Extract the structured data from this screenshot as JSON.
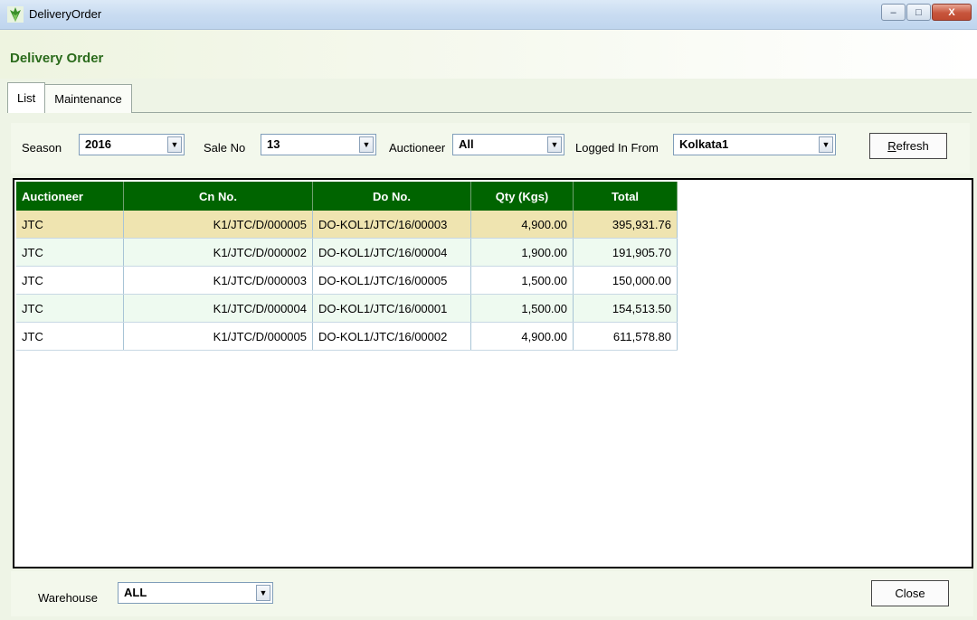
{
  "window": {
    "title": "DeliveryOrder",
    "controls": {
      "minimize": "–",
      "maximize": "□",
      "close": "X"
    }
  },
  "header": {
    "title": "Delivery Order"
  },
  "tabs": [
    {
      "label": "List",
      "active": true
    },
    {
      "label": "Maintenance",
      "active": false
    }
  ],
  "filters": {
    "season": {
      "label": "Season",
      "value": "2016"
    },
    "sale_no": {
      "label": "Sale No",
      "value": "13"
    },
    "auctioneer": {
      "label": "Auctioneer",
      "value": "All"
    },
    "logged_in_from": {
      "label": "Logged In From",
      "value": "Kolkata1"
    },
    "refresh_label": "Refresh"
  },
  "grid": {
    "columns": [
      "Auctioneer",
      "Cn No.",
      "Do No.",
      "Qty (Kgs)",
      "Total"
    ],
    "rows": [
      {
        "auctioneer": "JTC",
        "cn_no": "K1/JTC/D/000005",
        "do_no": "DO-KOL1/JTC/16/00003",
        "qty": "4,900.00",
        "total": "395,931.76"
      },
      {
        "auctioneer": "JTC",
        "cn_no": "K1/JTC/D/000002",
        "do_no": "DO-KOL1/JTC/16/00004",
        "qty": "1,900.00",
        "total": "191,905.70"
      },
      {
        "auctioneer": "JTC",
        "cn_no": "K1/JTC/D/000003",
        "do_no": "DO-KOL1/JTC/16/00005",
        "qty": "1,500.00",
        "total": "150,000.00"
      },
      {
        "auctioneer": "JTC",
        "cn_no": "K1/JTC/D/000004",
        "do_no": "DO-KOL1/JTC/16/00001",
        "qty": "1,500.00",
        "total": "154,513.50"
      },
      {
        "auctioneer": "JTC",
        "cn_no": "K1/JTC/D/000005",
        "do_no": "DO-KOL1/JTC/16/00002",
        "qty": "4,900.00",
        "total": "611,578.80"
      }
    ],
    "selected_row": 0
  },
  "footer": {
    "warehouse": {
      "label": "Warehouse",
      "value": "ALL"
    },
    "close_label": "Close"
  },
  "colors": {
    "header_green": "#2b6b1c",
    "grid_header": "#006400",
    "selected_row": "#efe4b0",
    "alt_row": "#eefaf0"
  },
  "icons": {
    "app": "leaf-app-icon",
    "dropdown": "chevron-down-icon"
  }
}
